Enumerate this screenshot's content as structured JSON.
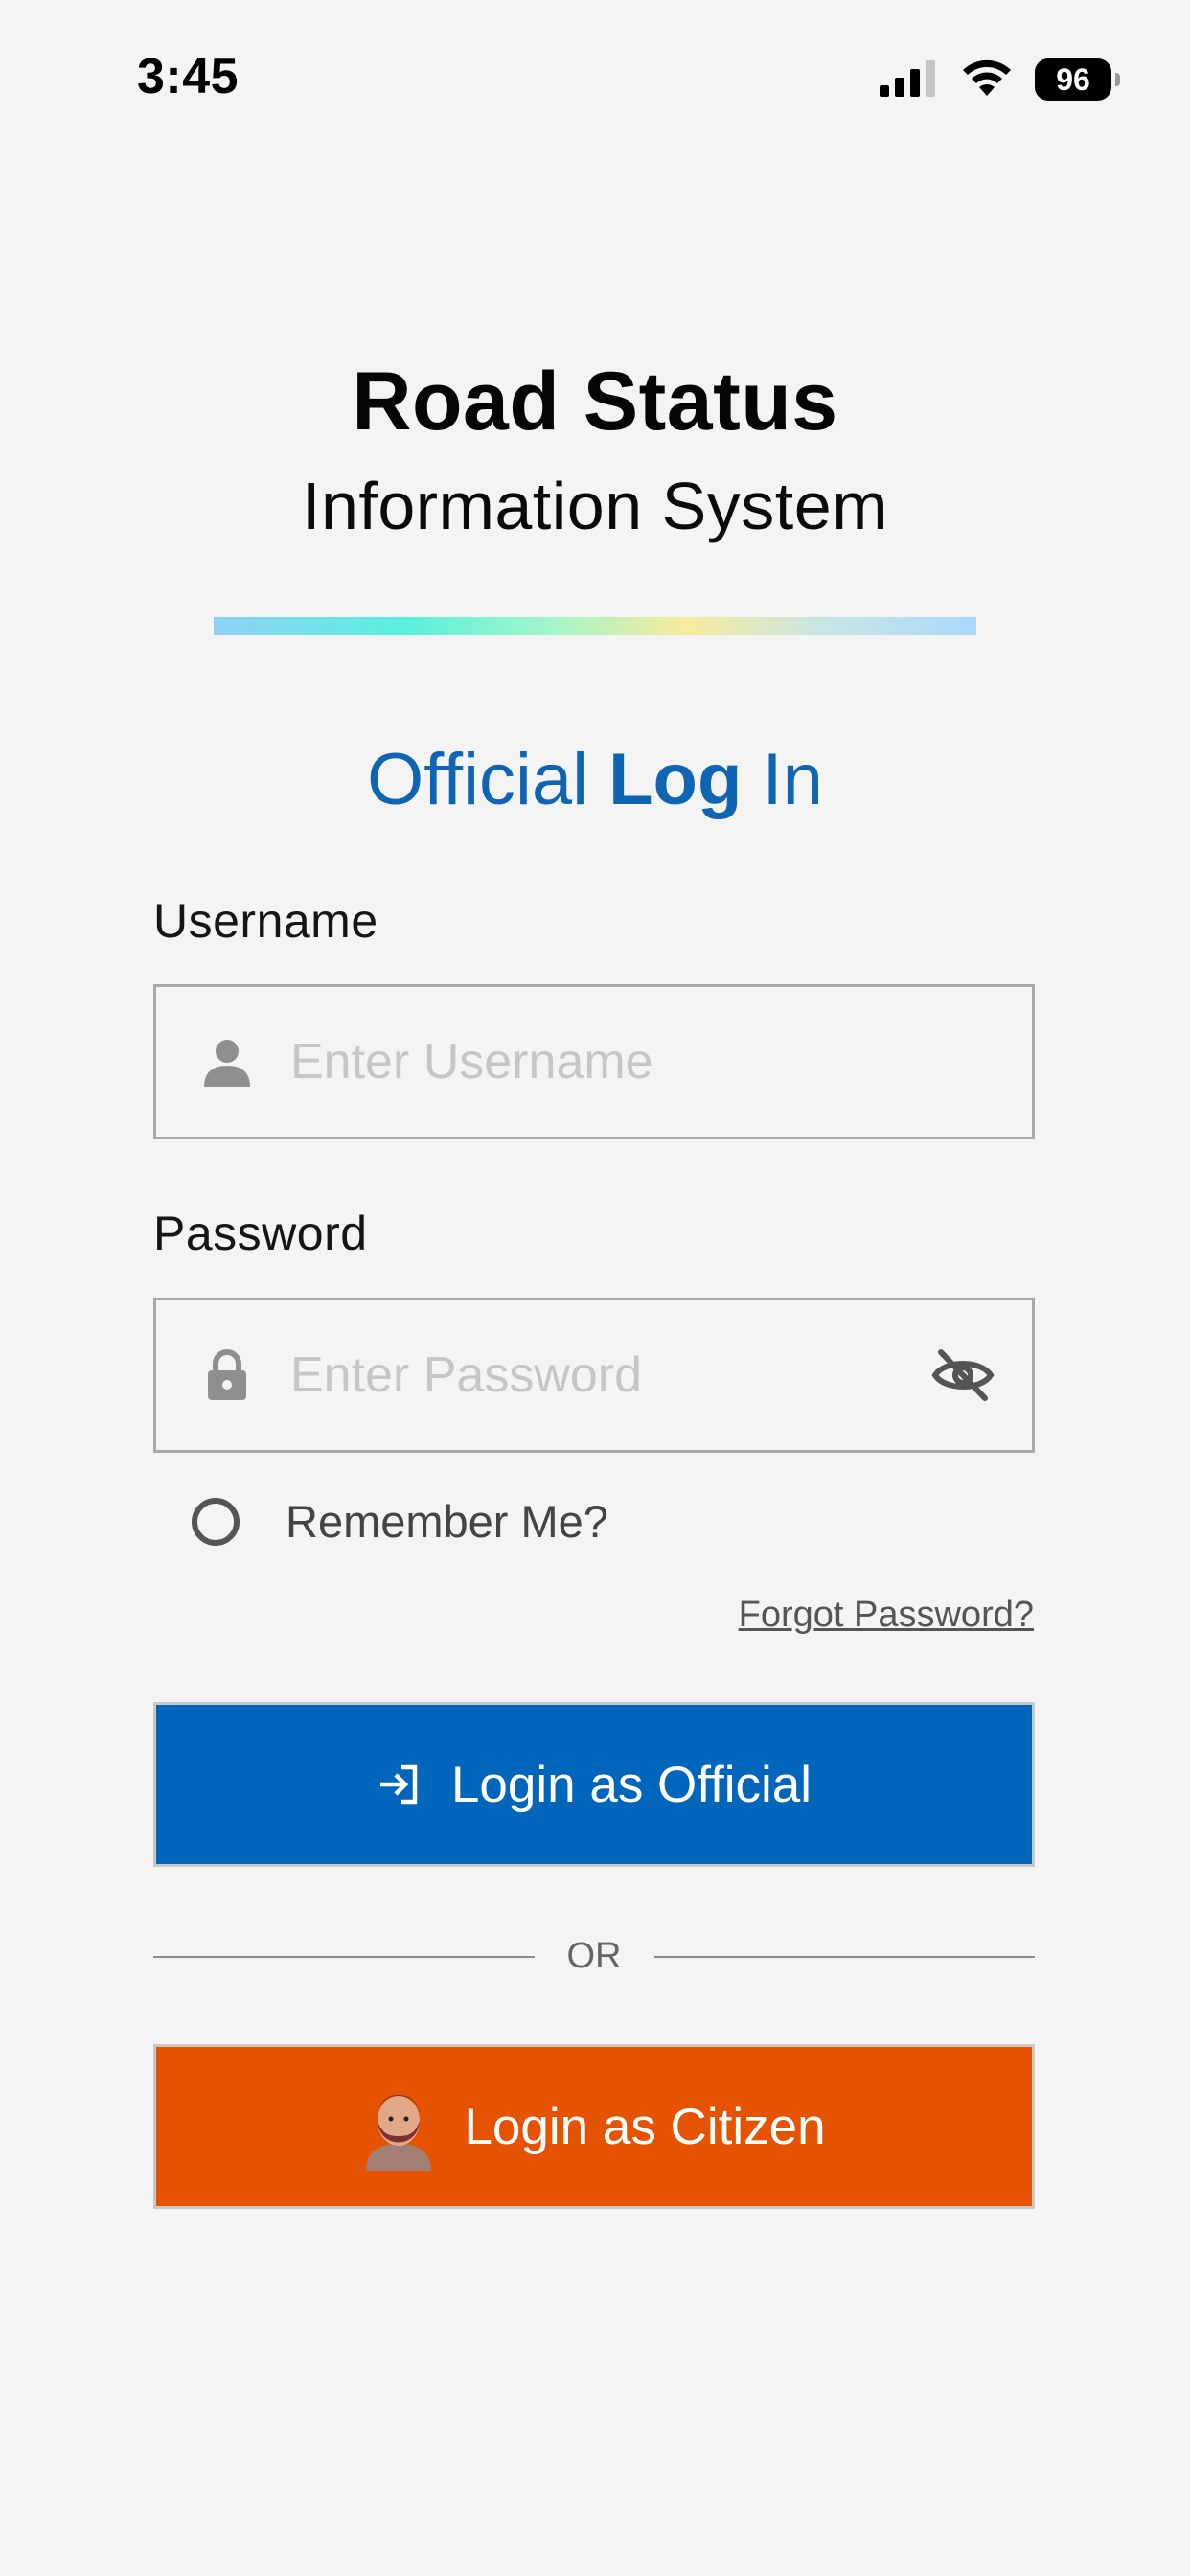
{
  "status_bar": {
    "time": "3:45",
    "battery": "96"
  },
  "title": {
    "line1": "Road Status",
    "line2": "Information System"
  },
  "heading": {
    "part1": "Official ",
    "part2": "Log",
    "part3": " In"
  },
  "form": {
    "username_label": "Username",
    "username_placeholder": "Enter Username",
    "password_label": "Password",
    "password_placeholder": "Enter Password",
    "remember_label": "Remember Me?",
    "forgot_label": "Forgot Password?"
  },
  "buttons": {
    "official_label": "Login as Official",
    "or_label": "OR",
    "citizen_label": "Login as Citizen"
  },
  "icons": {
    "username": "person-icon",
    "password": "lock-icon",
    "visibility": "eye-slash-icon",
    "official": "login-arrow-icon",
    "citizen": "avatar-icon"
  },
  "colors": {
    "accent_blue": "#0066bb",
    "heading_blue": "#0f64b4",
    "citizen_orange": "#e65300",
    "background": "#f4f4f4"
  }
}
